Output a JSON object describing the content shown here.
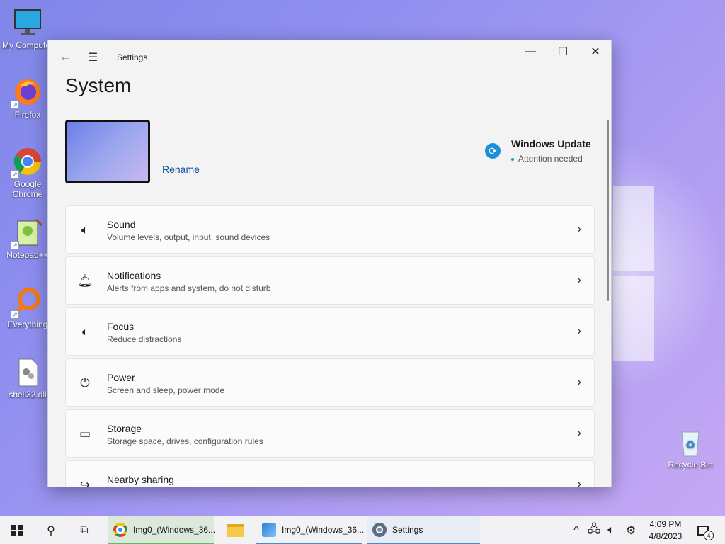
{
  "desktop": {
    "icons": [
      {
        "label": "My Computer",
        "icon": "monitor-icon"
      },
      {
        "label": "Firefox",
        "icon": "firefox-icon"
      },
      {
        "label": "Google Chrome",
        "icon": "chrome-icon"
      },
      {
        "label": "Notepad++",
        "icon": "notepadpp-icon"
      },
      {
        "label": "Everything",
        "icon": "everything-icon"
      },
      {
        "label": "shell32.dll",
        "icon": "dll-file-icon"
      },
      {
        "label": "Recycle Bin",
        "icon": "recycle-bin-icon"
      }
    ]
  },
  "window": {
    "app_title": "Settings",
    "page_title": "System",
    "rename_label": "Rename",
    "windows_update": {
      "title": "Windows Update",
      "status": "Attention needed"
    },
    "cards": [
      {
        "title": "Sound",
        "subtitle": "Volume levels, output, input, sound devices",
        "icon": "speaker-icon"
      },
      {
        "title": "Notifications",
        "subtitle": "Alerts from apps and system, do not disturb",
        "icon": "bell-icon"
      },
      {
        "title": "Focus",
        "subtitle": "Reduce distractions",
        "icon": "focus-icon"
      },
      {
        "title": "Power",
        "subtitle": "Screen and sleep, power mode",
        "icon": "power-icon"
      },
      {
        "title": "Storage",
        "subtitle": "Storage space, drives, configuration rules",
        "icon": "storage-icon"
      },
      {
        "title": "Nearby sharing",
        "subtitle": "",
        "icon": "share-icon"
      }
    ]
  },
  "taskbar": {
    "apps": [
      {
        "label": "Img0_(Windows_36...",
        "icon": "chrome-icon"
      },
      {
        "label": "",
        "icon": "folder-icon"
      },
      {
        "label": "Img0_(Windows_36...",
        "icon": "photos-icon"
      },
      {
        "label": "Settings",
        "icon": "settings-gear-icon"
      }
    ],
    "time": "4:09 PM",
    "date": "4/8/2023",
    "notification_count": "4"
  },
  "colors": {
    "accent": "#0a4d99",
    "update_blue": "#1d8fd8",
    "window_bg": "#f3f3f3"
  }
}
